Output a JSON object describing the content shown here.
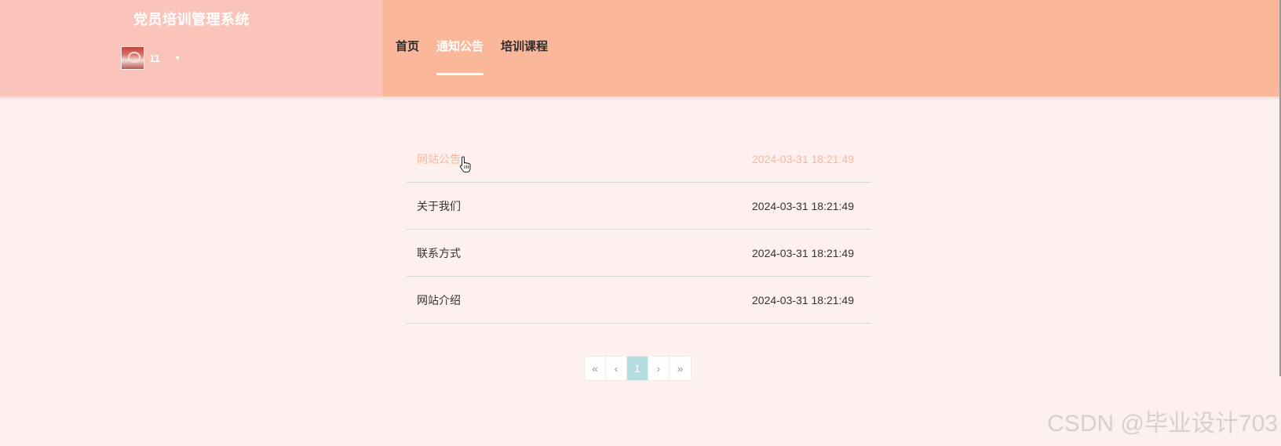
{
  "header": {
    "site_title": "党员培训管理系统",
    "user": {
      "name": "11",
      "avatar_icon": "user-avatar"
    },
    "nav": [
      {
        "label": "首页",
        "active": false
      },
      {
        "label": "通知公告",
        "active": true
      },
      {
        "label": "培训课程",
        "active": false
      }
    ]
  },
  "notices": [
    {
      "title": "网站公告",
      "time": "2024-03-31 18:21:49",
      "hovered": true
    },
    {
      "title": "关于我们",
      "time": "2024-03-31 18:21:49",
      "hovered": false
    },
    {
      "title": "联系方式",
      "time": "2024-03-31 18:21:49",
      "hovered": false
    },
    {
      "title": "网站介绍",
      "time": "2024-03-31 18:21:49",
      "hovered": false
    }
  ],
  "pagination": {
    "first": "«",
    "prev": "‹",
    "current": "1",
    "next": "›",
    "last": "»"
  },
  "watermark": "CSDN @毕业设计703",
  "colors": {
    "brand_panel": "#fac4bb",
    "nav_panel": "#fbb799",
    "page_bg": "#fdf0ef",
    "accent": "#fbb799",
    "pager_active": "#b5dce0"
  }
}
